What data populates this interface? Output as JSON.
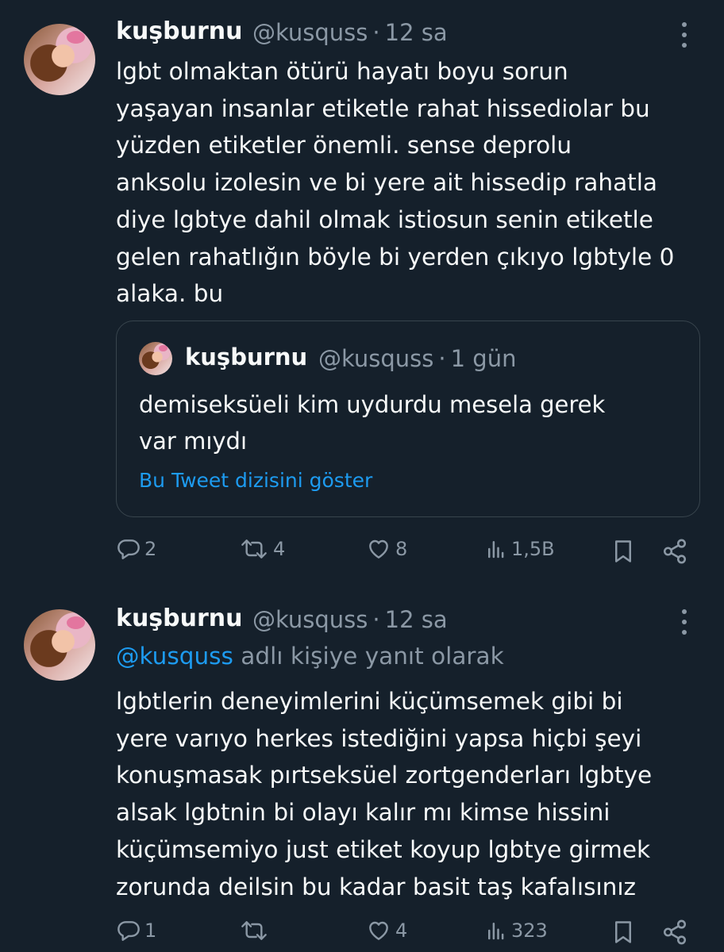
{
  "tweets": [
    {
      "display_name": "kuşburnu",
      "handle": "@kusquss",
      "time": "12 sa",
      "text": "lgbt olmaktan ötürü hayatı boyu sorun\nyaşayan insanlar etiketle rahat hissediolar bu\nyüzden etiketler önemli. sense deprolu\nanksolu izolesin ve bi yere ait hissedip rahatla\ndiye lgbtye dahil olmak istiosun senin etiketle\ngelen rahatlığın böyle bi yerden çıkıyo lgbtyle 0\nalaka. bu",
      "quoted": {
        "display_name": "kuşburnu",
        "handle": "@kusquss",
        "time": "1 gün",
        "text": "demiseksüeli kim uydurdu mesela gerek\nvar mıydı",
        "thread_link": "Bu Tweet dizisini göster"
      },
      "actions": {
        "replies": "2",
        "retweets": "4",
        "likes": "8",
        "views": "1,5B"
      }
    },
    {
      "display_name": "kuşburnu",
      "handle": "@kusquss",
      "time": "12 sa",
      "reply_to_handle": "@kusquss",
      "reply_to_suffix": "adlı kişiye yanıt olarak",
      "text": "lgbtlerin deneyimlerini küçümsemek gibi bi\nyere varıyo herkes istediğini yapsa hiçbi şeyi\nkonuşmasak pırtseksüel zortgenderları lgbtye\nalsak lgbtnin bi olayı kalır mı kimse hissini\nküçümsemiyo just etiket koyup lgbtye girmek\nzorunda deilsin bu kadar basit taş kafalısınız",
      "actions": {
        "replies": "1",
        "retweets": "",
        "likes": "4",
        "views": "323"
      }
    }
  ],
  "colors": {
    "background": "#15202b",
    "text": "#f7f9f9",
    "muted": "#8b98a5",
    "link": "#1d9bf0",
    "border": "#38444d"
  },
  "icons": [
    "more-icon",
    "reply-icon",
    "retweet-icon",
    "like-icon",
    "views-icon",
    "bookmark-icon",
    "share-icon"
  ]
}
